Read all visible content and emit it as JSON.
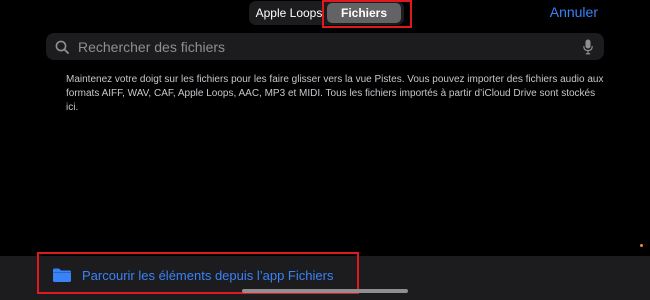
{
  "header": {
    "segments": [
      {
        "label": "Apple Loops",
        "selected": false
      },
      {
        "label": "Fichiers",
        "selected": true
      }
    ],
    "cancel_label": "Annuler"
  },
  "search": {
    "placeholder": "Rechercher des fichiers",
    "value": ""
  },
  "help_text": "Maintenez votre doigt sur les fichiers pour les faire glisser vers la vue Pistes. Vous pouvez importer des fichiers audio aux formats AIFF, WAV, CAF, Apple Loops, AAC, MP3 et MIDI. Tous les fichiers importés à partir d’iCloud Drive sont stockés ici.",
  "footer": {
    "browse_label": "Parcourir les éléments depuis l’app Fichiers",
    "icon": "folder-icon"
  },
  "colors": {
    "accent": "#3a82f7",
    "highlight": "#e0191f",
    "background": "#000000"
  }
}
